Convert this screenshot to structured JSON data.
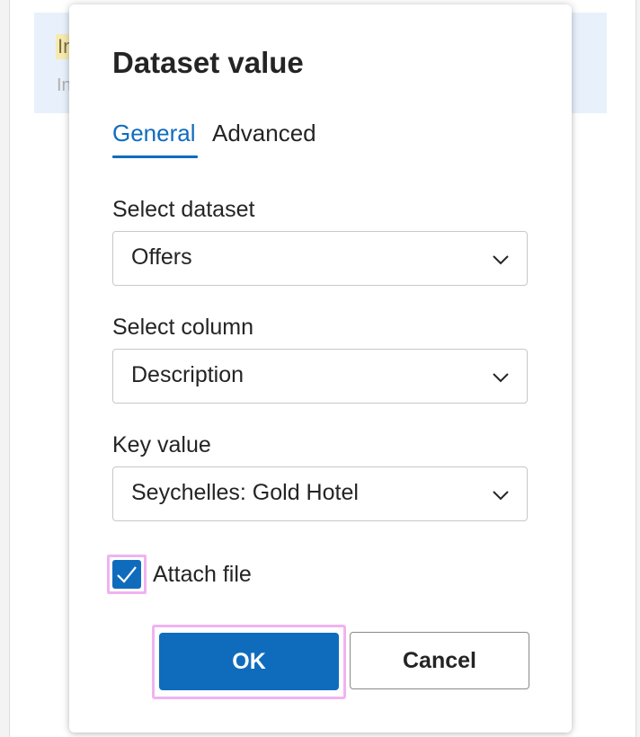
{
  "background": {
    "card_text_1": "In",
    "card_text_2": "In"
  },
  "dialog": {
    "title": "Dataset value",
    "tabs": [
      {
        "label": "General",
        "active": true
      },
      {
        "label": "Advanced",
        "active": false
      }
    ],
    "fields": [
      {
        "label": "Select dataset",
        "value": "Offers"
      },
      {
        "label": "Select column",
        "value": "Description"
      },
      {
        "label": "Key value",
        "value": "Seychelles: Gold Hotel"
      }
    ],
    "attach_file": {
      "label": "Attach file",
      "checked": true
    },
    "buttons": {
      "ok_label": "OK",
      "cancel_label": "Cancel"
    }
  },
  "colors": {
    "accent": "#0f6cbd",
    "highlight_outline": "#f0b3f0"
  },
  "icons": {
    "dropdown": "chevron-down-icon",
    "checkbox": "checkmark-icon"
  }
}
